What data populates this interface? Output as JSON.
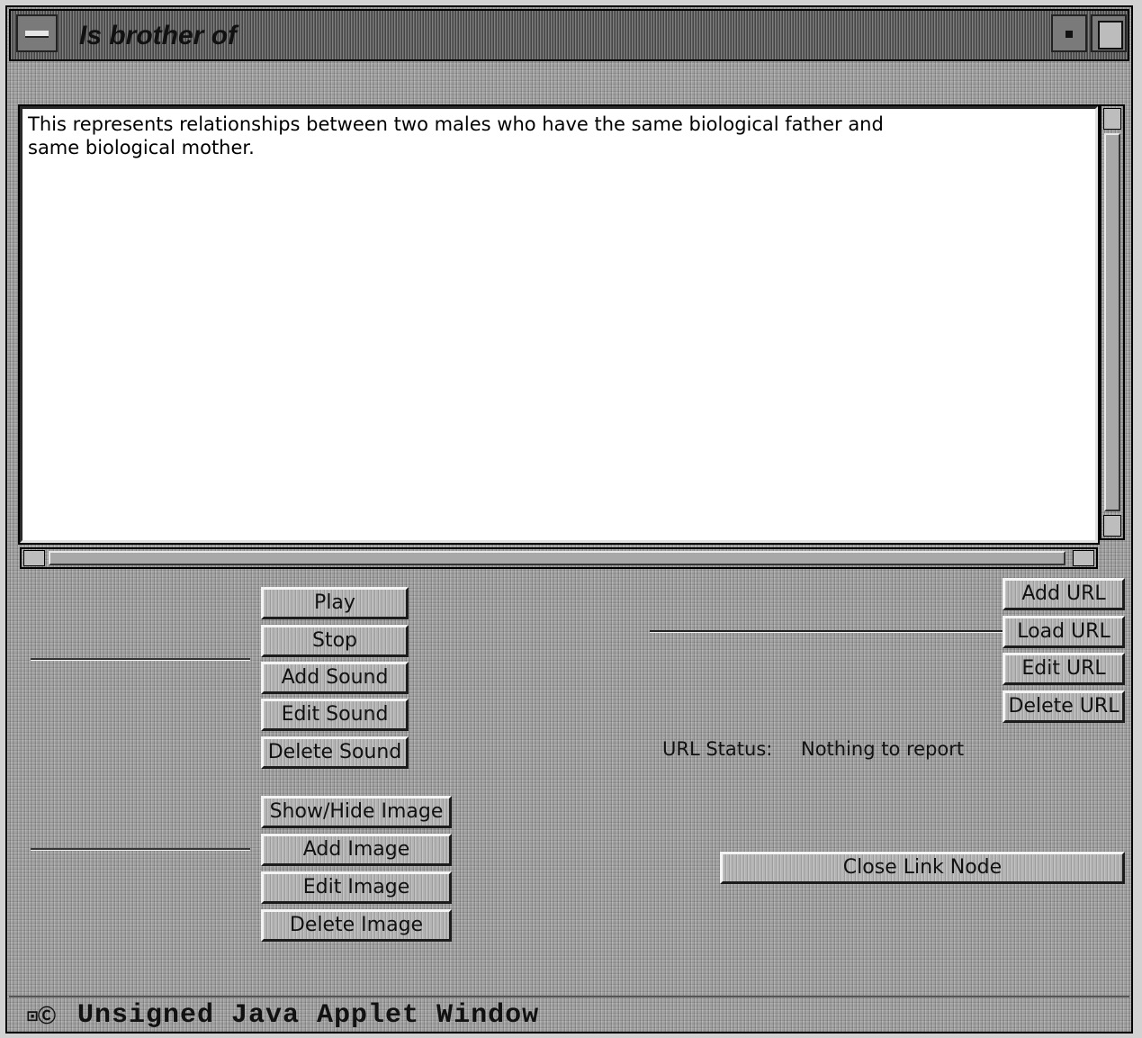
{
  "window": {
    "title": "Is brother of",
    "menu_icon": "window-menu-icon",
    "minimize_icon": "minimize-icon",
    "maximize_icon": "maximize-icon"
  },
  "description": {
    "text": "This represents relationships between two males who have the same biological father and\nsame biological mother."
  },
  "sound_buttons": {
    "play": "Play",
    "stop": "Stop",
    "add": "Add Sound",
    "edit": "Edit Sound",
    "delete": "Delete Sound"
  },
  "image_buttons": {
    "show_hide": "Show/Hide Image",
    "add": "Add Image",
    "edit": "Edit Image",
    "delete": "Delete Image"
  },
  "url_buttons": {
    "add": "Add URL",
    "load": "Load URL",
    "edit": "Edit URL",
    "delete": "Delete URL"
  },
  "url_status": {
    "label": "URL Status:",
    "value": "Nothing to report"
  },
  "close_button": "Close Link Node",
  "status_bar": {
    "icon": "java-applet-icon",
    "icon_glyph": "⊡Ⓒ",
    "text": "Unsigned Java Applet Window"
  },
  "colors": {
    "background": "#9f9f9f",
    "text_area": "#ffffff",
    "title_bar": "#5c5c5c"
  }
}
